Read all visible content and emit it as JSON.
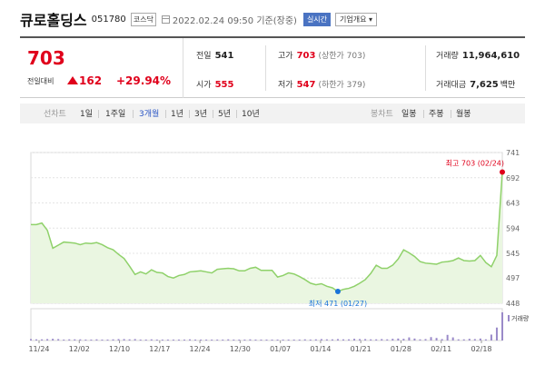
{
  "header": {
    "company": "큐로홀딩스",
    "code": "051780",
    "market": "코스닥",
    "datetime": "2022.02.24 09:50 기준(장중)",
    "realtime_label": "실시간",
    "corp_label": "기업개요 ▾"
  },
  "price": {
    "current": "703",
    "change_label": "전일대비",
    "change": "162",
    "change_rate": "+29.94%"
  },
  "stats": {
    "prev_close_label": "전일",
    "prev_close": "541",
    "high_label": "고가",
    "high": "703",
    "upper_limit": "(상한가 703)",
    "volume_label": "거래량",
    "volume": "11,964,610",
    "open_label": "시가",
    "open": "555",
    "low_label": "저가",
    "low": "547",
    "lower_limit": "(하한가 379)",
    "amount_label": "거래대금",
    "amount": "7,625",
    "amount_unit": "백만"
  },
  "tabs": {
    "line_label": "선차트",
    "line_periods": [
      "1일",
      "1주일",
      "3개월",
      "1년",
      "3년",
      "5년",
      "10년"
    ],
    "active_period": "3개월",
    "candle_label": "봉차트",
    "candle_periods": [
      "일봉",
      "주봉",
      "월봉"
    ]
  },
  "colors": {
    "rise": "#e0001b",
    "line": "#8fd16a",
    "area": "#eaf6e1",
    "volume": "#9a8ac9",
    "low_marker": "#1a73d9",
    "active_tab": "#2a55c4"
  },
  "chart_data": {
    "type": "area",
    "x_ticks": [
      "11/24",
      "12/02",
      "12/10",
      "12/17",
      "12/24",
      "12/30",
      "01/07",
      "01/14",
      "01/21",
      "01/28",
      "02/11",
      "02/18"
    ],
    "y_ticks": [
      741,
      692,
      643,
      594,
      545,
      497,
      448
    ],
    "ylim": [
      448,
      741
    ],
    "values": [
      601,
      601,
      604,
      590,
      555,
      561,
      567,
      566,
      565,
      562,
      565,
      564,
      566,
      562,
      556,
      552,
      543,
      535,
      520,
      504,
      509,
      505,
      513,
      508,
      507,
      500,
      497,
      502,
      504,
      509,
      510,
      511,
      509,
      507,
      514,
      515,
      516,
      515,
      511,
      511,
      516,
      518,
      512,
      512,
      512,
      499,
      502,
      507,
      505,
      500,
      494,
      487,
      484,
      486,
      481,
      478,
      471,
      475,
      477,
      481,
      487,
      494,
      506,
      522,
      516,
      516,
      522,
      534,
      552,
      546,
      539,
      529,
      526,
      525,
      524,
      528,
      529,
      531,
      536,
      531,
      530,
      531,
      541,
      527,
      519,
      541,
      703
    ],
    "volume": [
      0.05,
      0.04,
      0.04,
      0.05,
      0.06,
      0.05,
      0.03,
      0.04,
      0.04,
      0.04,
      0.03,
      0.03,
      0.04,
      0.03,
      0.03,
      0.04,
      0.05,
      0.05,
      0.04,
      0.05,
      0.03,
      0.03,
      0.04,
      0.03,
      0.03,
      0.03,
      0.03,
      0.03,
      0.03,
      0.04,
      0.03,
      0.03,
      0.03,
      0.03,
      0.03,
      0.03,
      0.04,
      0.03,
      0.03,
      0.03,
      0.04,
      0.03,
      0.03,
      0.03,
      0.03,
      0.03,
      0.03,
      0.03,
      0.03,
      0.03,
      0.04,
      0.03,
      0.04,
      0.05,
      0.04,
      0.04,
      0.05,
      0.04,
      0.04,
      0.06,
      0.05,
      0.05,
      0.04,
      0.04,
      0.05,
      0.04,
      0.06,
      0.07,
      0.06,
      0.11,
      0.07,
      0.04,
      0.05,
      0.12,
      0.09,
      0.05,
      0.2,
      0.11,
      0.04,
      0.04,
      0.06,
      0.05,
      0.07,
      0.04,
      0.21,
      0.46,
      1.0
    ],
    "volume_label": "거래량",
    "high_annotation": "최고 703 (02/24)",
    "low_annotation": "최저 471 (01/27)",
    "high_index": 86,
    "low_index": 56
  }
}
